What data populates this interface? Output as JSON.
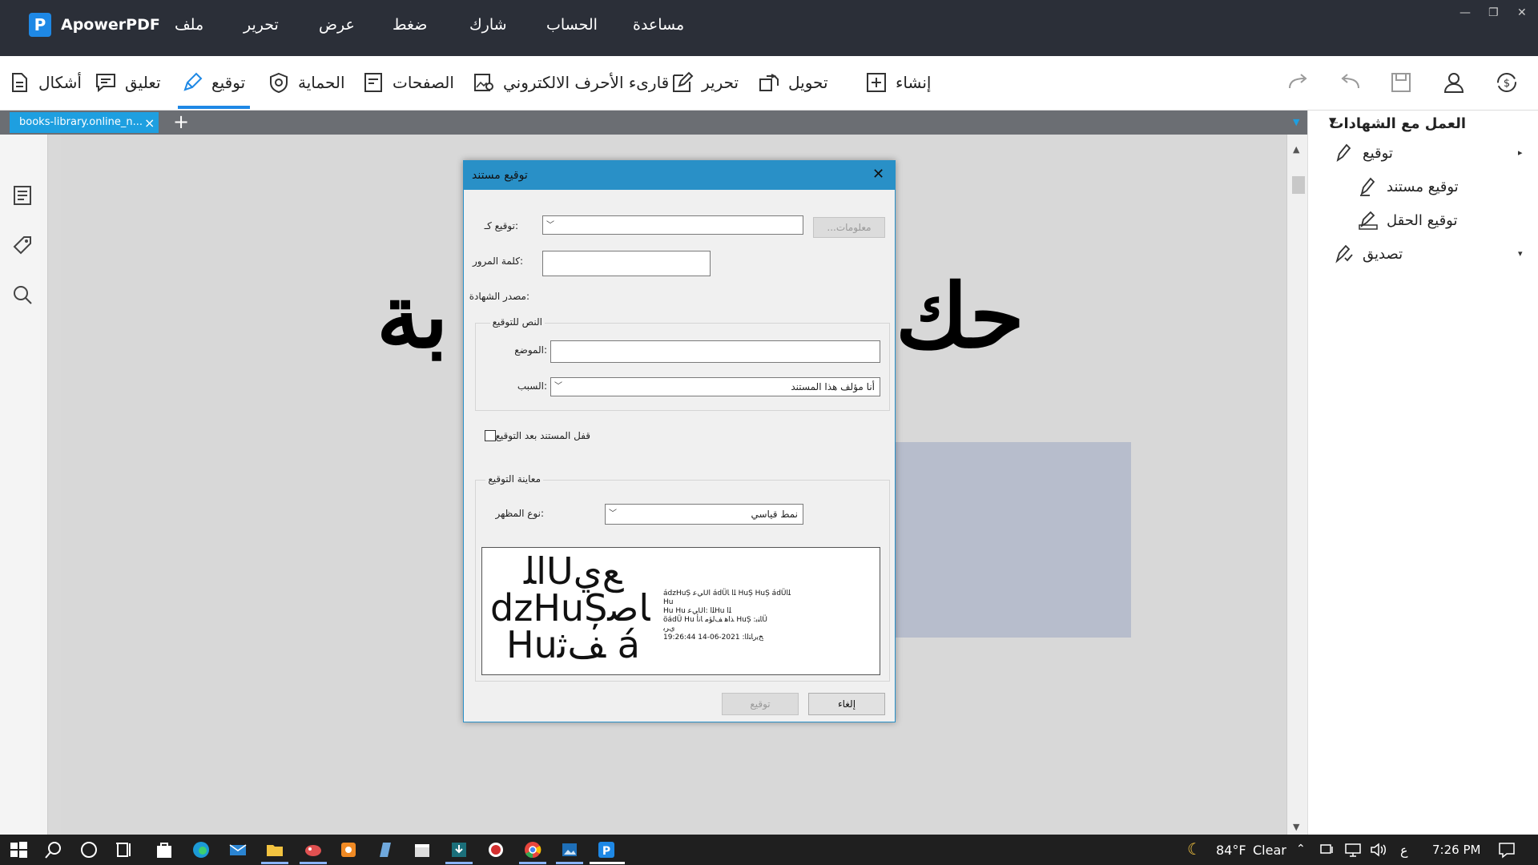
{
  "app": {
    "name": "ApowerPDF",
    "logo_letter": "P",
    "menus": [
      "ملف",
      "تحرير",
      "عرض",
      "ضغط",
      "شارك",
      "الحساب",
      "مساعدة"
    ],
    "window_controls": [
      "—",
      "❐",
      "✕"
    ]
  },
  "toolbar": {
    "tools": [
      {
        "label": "إنشاء",
        "icon": "plus-square-icon"
      },
      {
        "label": "تحويل",
        "icon": "convert-icon"
      },
      {
        "label": "تحرير",
        "icon": "edit-icon"
      },
      {
        "label": "قارىء الأحرف الالكتروني",
        "icon": "ocr-icon"
      },
      {
        "label": "الصفحات",
        "icon": "pages-icon"
      },
      {
        "label": "الحماية",
        "icon": "shield-icon"
      },
      {
        "label": "توقيع",
        "icon": "pen-icon"
      },
      {
        "label": "تعليق",
        "icon": "comment-icon"
      },
      {
        "label": "أشكال",
        "icon": "shapes-icon"
      }
    ],
    "active_tool": "توقيع",
    "accent": "#1e88e5"
  },
  "tabs": {
    "document_tab": "books-library.online_n...",
    "close": "×",
    "add": "+"
  },
  "document": {
    "text_left": "بة",
    "text_right": "حك"
  },
  "right_panel": {
    "header": "العمل مع الشهادات",
    "items": [
      {
        "label": "توقيع",
        "level": 1
      },
      {
        "label": "توقيع مستند",
        "level": 2
      },
      {
        "label": "توقيع الحقل",
        "level": 2
      },
      {
        "label": "تصديق",
        "level": 1
      }
    ]
  },
  "dialog": {
    "title": "توقيع مستند",
    "sign_as_label": "توقيع كـ:",
    "info_button": "معلومات...",
    "password_label": "كلمة المرور:",
    "password_value": "",
    "cert_issuer_label": "مصدر الشهادة:",
    "text_group_title": "النص للتوقيع",
    "location_label": "الموضع:",
    "location_value": "",
    "reason_label": "السبب:",
    "reason_value": "أنا مؤلف هذا المستند",
    "lock_label": "قفل المستند بعد التوقيع",
    "preview_group_title": "معاينة التوقيع",
    "appearance_label": "نوع المظهر:",
    "appearance_value": "نمط قياسي",
    "preview_big_lines": [
      "ﺍﻠUﻊﻱ",
      "dzHuȘﺎﺻ",
      "Huﻒﺛ á"
    ],
    "preview_small_text": "ádzHuȘ ﻲﻋUl ádÜﻠﺍ ﺎ HuȘ HuȘ ádÜﻠﺍ\nHu\nHu Hu ﻲﻋUﻠﺍ :ﺍHu ﻠﺍ\nöádÜ Hu ﺬﺍﻫ ﻒﻟﺆﻣ ﺎﻧﺃ HuȘ :ﺎﻨﺑÜ\nﻱﺮﺑ\n19:26:44 14-06-2021 :ﺦﻳﺭﺎﺘﻟﺍ",
    "sign_button": "توقيع",
    "cancel_button": "إلغاء"
  },
  "taskbar": {
    "weather_temp": "84°F",
    "weather_desc": "Clear",
    "ime": "ع",
    "time": "7:26 PM"
  }
}
